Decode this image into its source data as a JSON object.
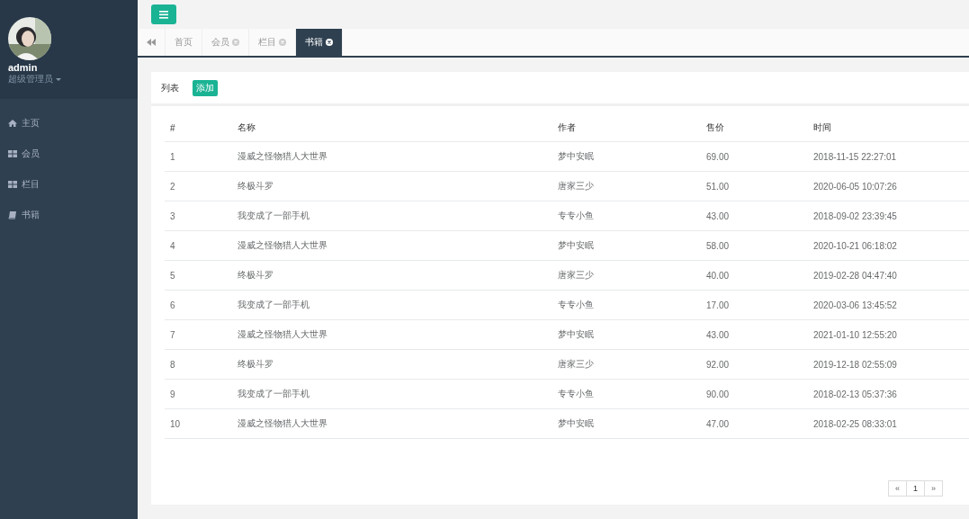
{
  "sidebar": {
    "user": {
      "name": "admin",
      "role": "超级管理员"
    },
    "items": [
      {
        "kind": "home",
        "label": "主页",
        "selected": false
      },
      {
        "kind": "grid",
        "label": "会员",
        "selected": false
      },
      {
        "kind": "grid",
        "label": "栏目",
        "selected": false
      },
      {
        "kind": "book",
        "label": "书籍",
        "selected": false
      }
    ]
  },
  "tabs": [
    {
      "label": "首页",
      "closable": false,
      "selected": false
    },
    {
      "label": "会员",
      "closable": true,
      "selected": false
    },
    {
      "label": "栏目",
      "closable": true,
      "selected": false
    },
    {
      "label": "书籍",
      "closable": true,
      "selected": true
    }
  ],
  "panel": {
    "title": "列表",
    "add_button": "添加"
  },
  "table": {
    "columns": [
      "#",
      "名称",
      "作者",
      "售价",
      "时间"
    ],
    "rows": [
      [
        "1",
        "漫威之怪物猎人大世界",
        "梦中安眠",
        "69.00",
        "2018-11-15 22:27:01"
      ],
      [
        "2",
        "终极斗罗",
        "唐家三少",
        "51.00",
        "2020-06-05 10:07:26"
      ],
      [
        "3",
        "我变成了一部手机",
        "专专小鱼",
        "43.00",
        "2018-09-02 23:39:45"
      ],
      [
        "4",
        "漫威之怪物猎人大世界",
        "梦中安眠",
        "58.00",
        "2020-10-21 06:18:02"
      ],
      [
        "5",
        "终极斗罗",
        "唐家三少",
        "40.00",
        "2019-02-28 04:47:40"
      ],
      [
        "6",
        "我变成了一部手机",
        "专专小鱼",
        "17.00",
        "2020-03-06 13:45:52"
      ],
      [
        "7",
        "漫威之怪物猎人大世界",
        "梦中安眠",
        "43.00",
        "2021-01-10 12:55:20"
      ],
      [
        "8",
        "终极斗罗",
        "唐家三少",
        "92.00",
        "2019-12-18 02:55:09"
      ],
      [
        "9",
        "我变成了一部手机",
        "专专小鱼",
        "90.00",
        "2018-02-13 05:37:36"
      ],
      [
        "10",
        "漫威之怪物猎人大世界",
        "梦中安眠",
        "47.00",
        "2018-02-25 08:33:01"
      ]
    ]
  },
  "pagination": {
    "prev": "«",
    "pages": [
      {
        "label": "1",
        "selected": true
      }
    ],
    "next": "»"
  }
}
